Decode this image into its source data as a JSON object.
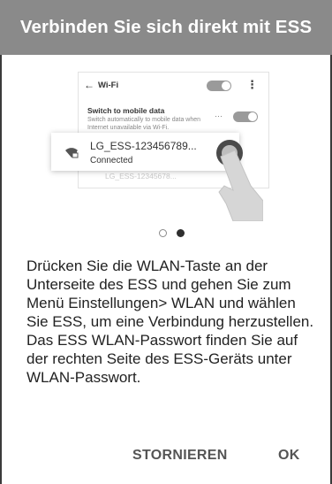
{
  "dialog": {
    "title": "Verbinden Sie sich direkt mit ESS",
    "message": "Drücken Sie die WLAN-Taste an der Unterseite des ESS und gehen Sie zum Menü Einstellungen> WLAN und wählen Sie ESS, um eine Verbindung herzustellen. Das ESS WLAN-Passwort finden Sie auf der rechten Seite des ESS-Geräts unter WLAN-Passwort.",
    "cancel_label": "STORNIEREN",
    "ok_label": "OK"
  },
  "illustration": {
    "screen_title": "Wi-Fi",
    "back_icon": "arrow-left-icon",
    "more_icon": "more-vert-icon",
    "switch_title": "Switch to mobile data",
    "switch_desc": "Switch automatically to mobile data when Internet unavailable via Wi-Fi.",
    "switch_more": "···",
    "network_ssid": "LG_ESS-123456789...",
    "network_status": "Connected",
    "background_ssid": "LG_ESS-12345678..."
  },
  "pager": {
    "count": 2,
    "active_index": 1
  },
  "colors": {
    "header_bg": "#8a8a8a",
    "text": "#222222",
    "button": "#555555"
  }
}
